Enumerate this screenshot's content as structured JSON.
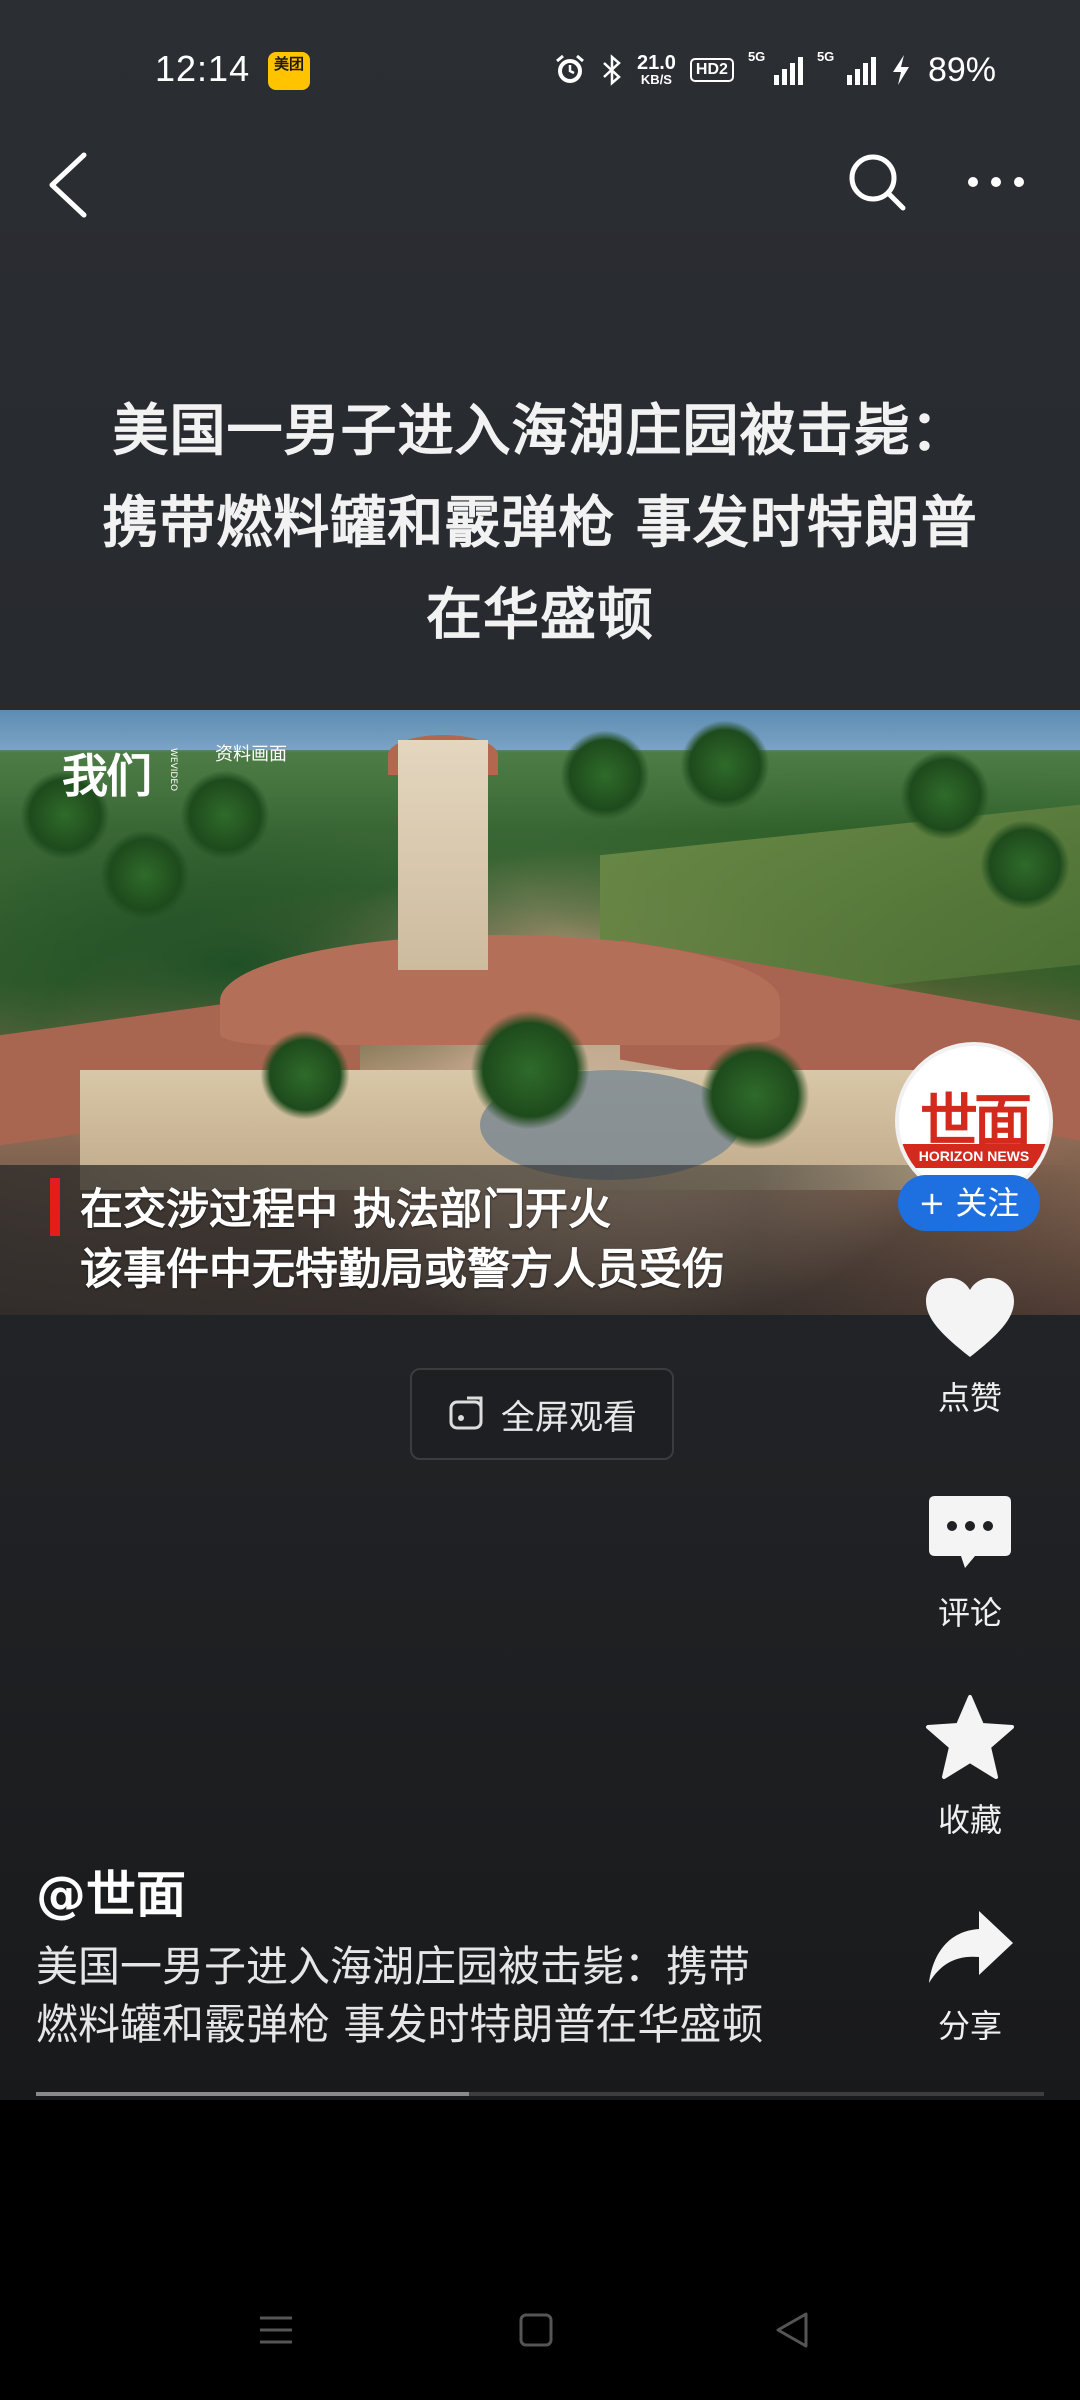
{
  "status_bar": {
    "time": "12:14",
    "app_badge": "美团",
    "net_speed_value": "21.0",
    "net_speed_unit": "KB/S",
    "hd_label": "HD2",
    "signal1_label": "5G",
    "signal2_label": "5G",
    "battery": "89%"
  },
  "headline": {
    "line1": "美国一男子进入海湖庄园被击毙：",
    "line2": "携带燃料罐和霰弹枪  事发时特朗普",
    "line3": "在华盛顿"
  },
  "video": {
    "source_logo": "我们",
    "source_logo_sub": "WEVIDEO",
    "tag": "资料画面",
    "caption_line1": "在交涉过程中 执法部门开火",
    "caption_line2": "该事件中无特勤局或警方人员受伤",
    "progress": 0.43
  },
  "fullscreen_label": "全屏观看",
  "author_avatar": {
    "name": "世面",
    "sub": "HORIZON NEWS"
  },
  "follow_label": "+ 关注",
  "actions": {
    "like": "点赞",
    "comment": "评论",
    "favorite": "收藏",
    "share": "分享"
  },
  "author_handle": "@世面",
  "description_line1": "美国一男子进入海湖庄园被击毙：携带",
  "description_line2": "燃料罐和霰弹枪 事发时特朗普在华盛顿"
}
